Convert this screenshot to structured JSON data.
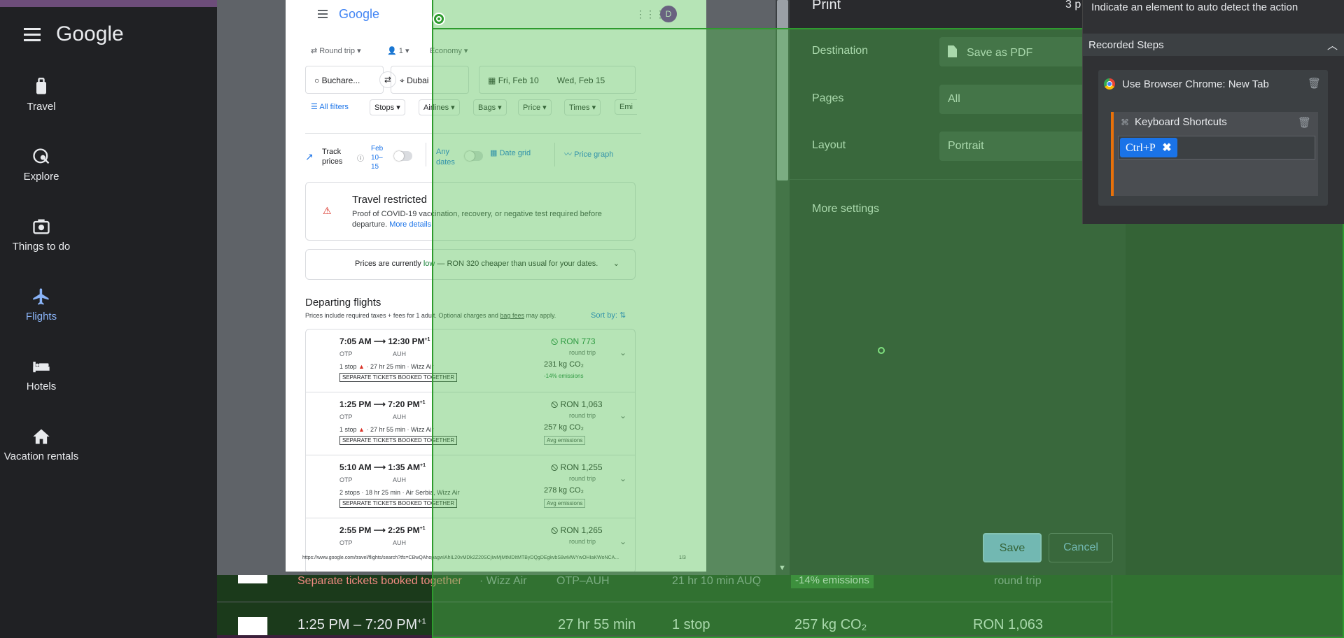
{
  "left_nav": {
    "logo": "Google",
    "items": [
      {
        "label": "Travel",
        "icon": "travel-bag-icon"
      },
      {
        "label": "Explore",
        "icon": "explore-icon"
      },
      {
        "label": "Things to do",
        "icon": "camera-icon"
      },
      {
        "label": "Flights",
        "icon": "airplane-icon"
      },
      {
        "label": "Hotels",
        "icon": "bed-icon"
      },
      {
        "label": "Vacation rentals",
        "icon": "house-icon"
      }
    ]
  },
  "paper": {
    "logo": "Google",
    "avatar": "D",
    "trip_type": "Round trip",
    "passengers": "1",
    "cabin": "Economy",
    "origin": "Buchare...",
    "destination": "Dubai",
    "depart_date": "Fri, Feb 10",
    "return_date": "Wed, Feb 15",
    "filters": [
      "All filters",
      "Stops",
      "Airlines",
      "Bags",
      "Price",
      "Times",
      "Emi"
    ],
    "track_prices": "Track prices",
    "track_dates": "Feb 10–15",
    "any_dates": "Any dates",
    "date_grid": "Date grid",
    "price_graph": "Price graph",
    "alert_title": "Travel restricted",
    "alert_body": "Proof of COVID-19 vaccination, recovery, or negative test required before departure.",
    "alert_link": "More details",
    "prices_note_prefix": "Prices are currently ",
    "prices_note_low": "low",
    "prices_note_suffix": " — RON 320 cheaper than usual for your dates.",
    "departing_title": "Departing flights",
    "departing_sub_a": "Prices include required taxes + fees for 1 adult. Optional charges and ",
    "departing_sub_link": "bag fees",
    "departing_sub_b": " may apply.",
    "sort_by": "Sort by:",
    "flights": [
      {
        "times": "7:05 AM ⟶ 12:30 PM",
        "sup": "+1",
        "from": "OTP",
        "to": "AUH",
        "stops": "1 stop",
        "duration": "27 hr 25 min",
        "airline": "Wizz Air",
        "tag": "SEPARATE TICKETS BOOKED TOGETHER",
        "price": "RON 773",
        "price_green": true,
        "trip": "round trip",
        "co2": "231 kg CO₂",
        "emissions": "-14% emissions",
        "warn": true
      },
      {
        "times": "1:25 PM ⟶ 7:20 PM",
        "sup": "+1",
        "from": "OTP",
        "to": "AUH",
        "stops": "1 stop",
        "duration": "27 hr 55 min",
        "airline": "Wizz Air",
        "tag": "SEPARATE TICKETS BOOKED TOGETHER",
        "price": "RON 1,063",
        "price_green": false,
        "trip": "round trip",
        "co2": "257 kg CO₂",
        "emissions": "Avg emissions",
        "warn": true
      },
      {
        "times": "5:10 AM ⟶ 1:35 AM",
        "sup": "+1",
        "from": "OTP",
        "to": "AUH",
        "stops": "2 stops",
        "duration": "18 hr 25 min",
        "airline": "Air Serbia, Wizz Air",
        "tag": "SEPARATE TICKETS BOOKED TOGETHER",
        "price": "RON 1,255",
        "price_green": false,
        "trip": "round trip",
        "co2": "278 kg CO₂",
        "emissions": "Avg emissions",
        "warn": false
      },
      {
        "times": "2:55 PM ⟶ 2:25 PM",
        "sup": "+1",
        "from": "OTP",
        "to": "AUH",
        "stops": "",
        "duration": "",
        "airline": "",
        "tag": "",
        "price": "RON 1,265",
        "price_green": false,
        "trip": "round trip",
        "co2": "",
        "emissions": "",
        "warn": false
      }
    ],
    "footer_url": "https://www.google.com/travel/flights/search?tfs=CBwQAhopagwIAhIL20vMDk2Z20SCjIwMjMtMDItMTByDQgDEgkvbS8wMWYwOHIaKWoNCA...",
    "footer_page": "1/3"
  },
  "dialog": {
    "title": "Print",
    "sheets": "3 p",
    "destination_label": "Destination",
    "destination_value": "Save as PDF",
    "pages_label": "Pages",
    "pages_value": "All",
    "layout_label": "Layout",
    "layout_value": "Portrait",
    "more_settings": "More settings",
    "save": "Save",
    "cancel": "Cancel"
  },
  "background_page": {
    "row1_tag": "Separate tickets booked together",
    "row1_airline": "· Wizz Air",
    "row1_route": "OTP–AUH",
    "row1_layover": "21 hr 10 min AUQ",
    "row1_emissions": "-14% emissions",
    "row1_trip": "round trip",
    "row2_times": "1:25 PM – 7:20 PM",
    "row2_sup": "+1",
    "row2_duration": "27 hr 55 min",
    "row2_stops": "1 stop",
    "row2_co2": "257 kg CO₂",
    "row2_price": "RON 1,063"
  },
  "recorder": {
    "hint": "Indicate an element to auto detect the action",
    "section": "Recorded Steps",
    "step1": "Use Browser Chrome: New Tab",
    "step2": "Keyboard Shortcuts",
    "shortcut": "Ctrl+P"
  },
  "colors": {
    "accent_blue": "#1a73e8",
    "green_overlay": "#50be50",
    "price_green": "#188038",
    "warn_red": "#d93025"
  }
}
